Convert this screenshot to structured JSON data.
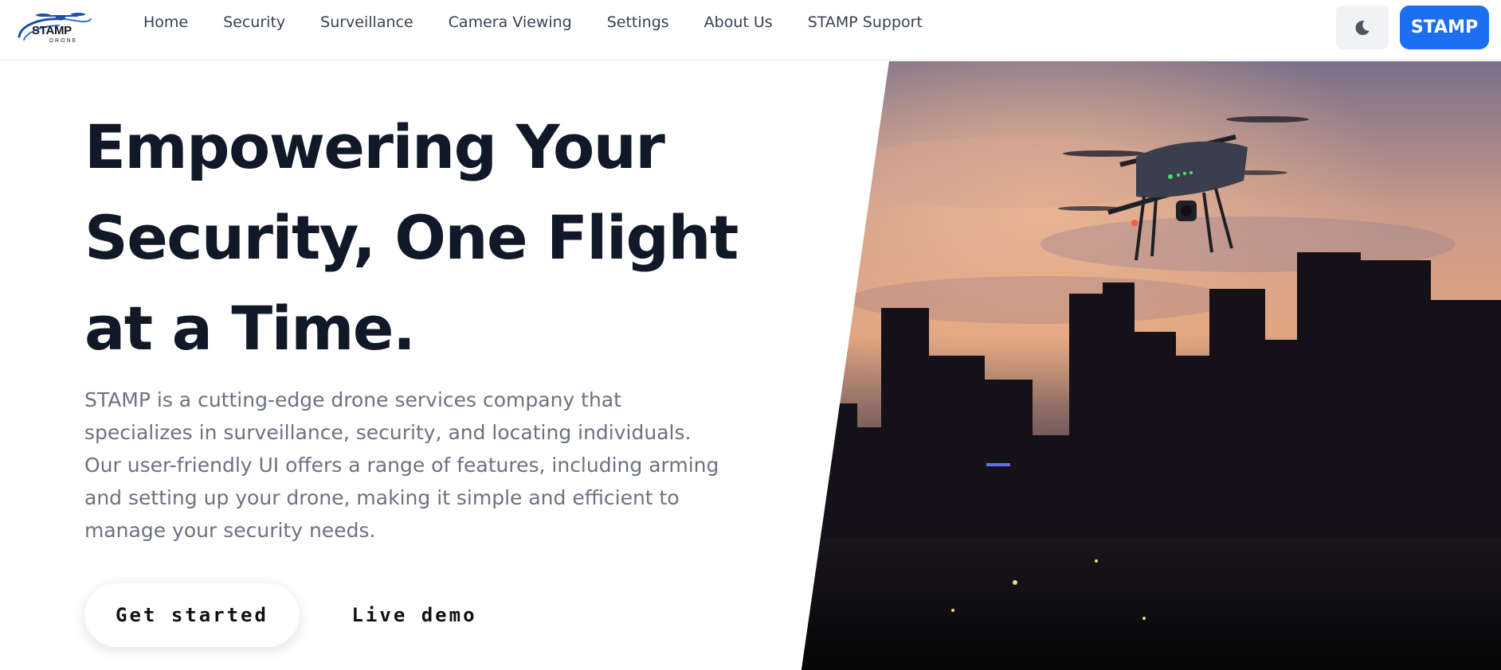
{
  "brand": {
    "logo_main": "STAMP",
    "logo_sub": "DRONE"
  },
  "nav": {
    "items": [
      {
        "label": "Home"
      },
      {
        "label": "Security"
      },
      {
        "label": "Surveillance"
      },
      {
        "label": "Camera Viewing"
      },
      {
        "label": "Settings"
      },
      {
        "label": "About Us"
      },
      {
        "label": "STAMP Support"
      }
    ]
  },
  "header": {
    "theme_toggle_icon": "moon-icon",
    "cta_label": "STAMP"
  },
  "hero": {
    "title": "Empowering Your Security, One Flight at a Time.",
    "description": "STAMP is a cutting-edge drone services company that specializes in surveillance, security, and locating individuals. Our user-friendly UI offers a range of features, including arming and setting up your drone, making it simple and efficient to manage your security needs.",
    "primary_button": "Get started",
    "secondary_button": "Live demo",
    "image_icon": "drone-city-sunset-photo"
  },
  "colors": {
    "accent": "#1d6ff2",
    "heading": "#111827",
    "body_text": "#6b7280",
    "nav_text": "#374151",
    "toggle_bg": "#f0f2f5"
  }
}
